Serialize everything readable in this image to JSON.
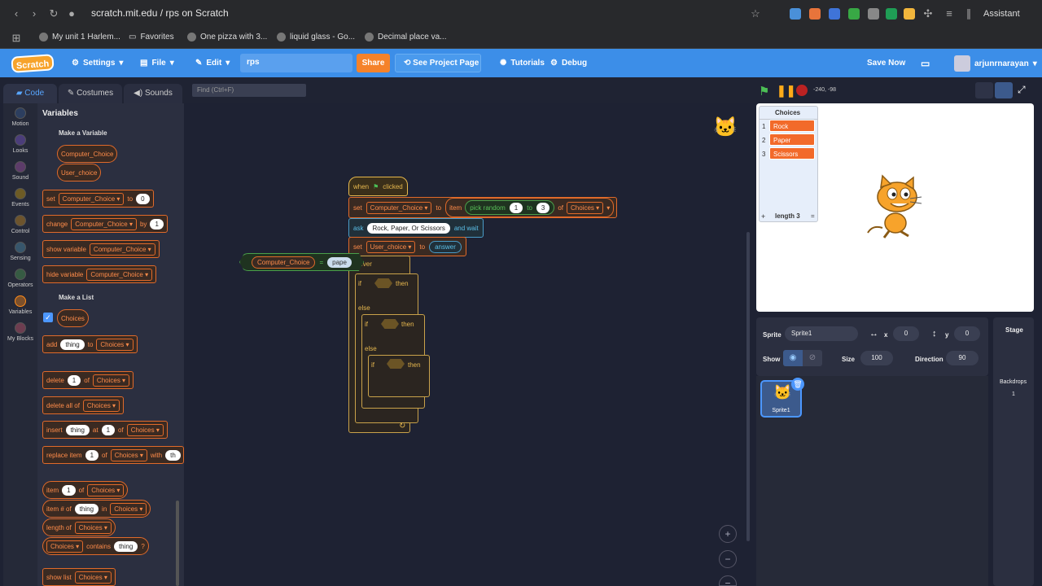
{
  "browser": {
    "url": "scratch.mit.edu / rps on Scratch",
    "assistant": "Assistant",
    "bookmarks": [
      "My unit 1 Harlem...",
      "Favorites",
      "One pizza with 3...",
      "liquid glass - Go...",
      "Decimal place va..."
    ]
  },
  "menu": {
    "logo": "Scratch",
    "settings": "Settings",
    "file": "File",
    "edit": "Edit",
    "project_title": "rps",
    "share": "Share",
    "see_project": "See Project Page",
    "tutorials": "Tutorials",
    "debug": "Debug",
    "save_now": "Save Now",
    "username": "arjunrnarayan"
  },
  "tabs": {
    "code": "Code",
    "costumes": "Costumes",
    "sounds": "Sounds"
  },
  "categories": [
    {
      "label": "Motion",
      "color": "#4c97ff"
    },
    {
      "label": "Looks",
      "color": "#9966ff"
    },
    {
      "label": "Sound",
      "color": "#cf63cf"
    },
    {
      "label": "Events",
      "color": "#ffbf00"
    },
    {
      "label": "Control",
      "color": "#ffab19"
    },
    {
      "label": "Sensing",
      "color": "#5cb1d6"
    },
    {
      "label": "Operators",
      "color": "#59c059"
    },
    {
      "label": "Variables",
      "color": "#ff8c1a"
    },
    {
      "label": "My Blocks",
      "color": "#ff6680"
    }
  ],
  "palette": {
    "title": "Variables",
    "make_variable": "Make a Variable",
    "var1": "Computer_Choice",
    "var2": "User_choice",
    "set": "set",
    "to": "to",
    "zero": "0",
    "change": "change",
    "by": "by",
    "one": "1",
    "show_variable": "show variable",
    "hide_variable": "hide variable",
    "make_list": "Make a List",
    "list_name": "Choices",
    "add": "add",
    "thing": "thing",
    "delete": "delete",
    "of": "of",
    "delete_all": "delete all of",
    "insert": "insert",
    "at": "at",
    "replace_item": "replace item",
    "with": "with",
    "with_value": "th",
    "item": "item",
    "item_num": "item # of",
    "in": "in",
    "length_of": "length of",
    "contains": "contains",
    "question": "?",
    "show_list": "show list"
  },
  "code": {
    "find_placeholder": "Find (Ctrl+F)",
    "when": "when",
    "clicked": "clicked",
    "set": "set",
    "var1": "Computer_Choice",
    "to": "to",
    "item": "item",
    "pick_random": "pick random",
    "from": "1",
    "to_num": "3",
    "of": "of",
    "list": "Choices",
    "ask": "ask",
    "question": "Rock, Paper, Or Scissors",
    "and_wait": "and wait",
    "var2": "User_choice",
    "answer": "answer",
    "forever": "forever",
    "if": "if",
    "then": "then",
    "else": "else",
    "loose_var": "Computer_Choice",
    "equals": "=",
    "loose_val": "pape",
    "zoom_in": "+",
    "zoom_out": "−",
    "zoom_reset": "="
  },
  "stage": {
    "coords": "-240, -98",
    "list_title": "Choices",
    "items": [
      "Rock",
      "Paper",
      "Scissors"
    ],
    "plus": "+",
    "length": "length 3",
    "equals": "="
  },
  "sprite": {
    "sprite_label": "Sprite",
    "name": "Sprite1",
    "x_label": "x",
    "x": "0",
    "y_label": "y",
    "y": "0",
    "show_label": "Show",
    "size_label": "Size",
    "size": "100",
    "direction_label": "Direction",
    "direction": "90",
    "thumb_label": "Sprite1",
    "stage_label": "Stage",
    "backdrops_label": "Backdrops",
    "backdrops": "1"
  }
}
